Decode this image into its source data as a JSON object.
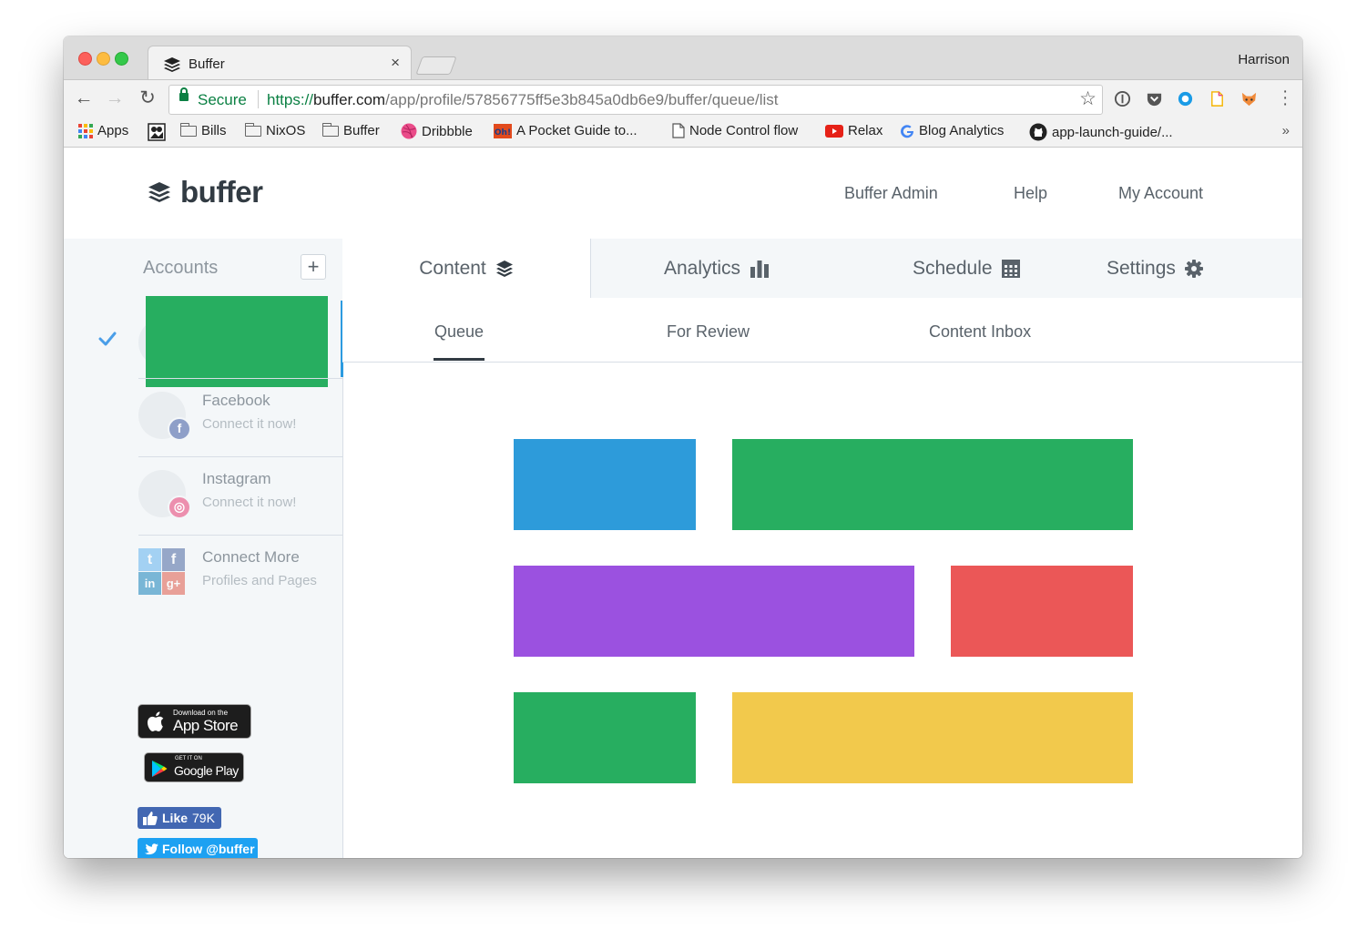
{
  "browser": {
    "tab_title": "Buffer",
    "tab_close": "×",
    "profile_name": "Harrison",
    "secure_label": "Secure",
    "url_scheme": "https://",
    "url_host": "buffer.com",
    "url_path": "/app/profile/57856775ff5e3b845a0db6e9/buffer/queue/list",
    "bookmarks": [
      {
        "label": "Apps",
        "icon": "apps-grid-icon"
      },
      {
        "label": "",
        "icon": "photo-icon"
      },
      {
        "label": "Bills",
        "icon": "folder-icon"
      },
      {
        "label": "NixOS",
        "icon": "folder-icon"
      },
      {
        "label": "Buffer",
        "icon": "folder-icon"
      },
      {
        "label": "Dribbble",
        "icon": "dribbble-icon"
      },
      {
        "label": "A Pocket Guide to...",
        "icon": "oh-icon"
      },
      {
        "label": "Node Control flow",
        "icon": "page-icon"
      },
      {
        "label": "Relax",
        "icon": "youtube-icon"
      },
      {
        "label": "Blog Analytics",
        "icon": "google-icon"
      },
      {
        "label": "app-launch-guide/...",
        "icon": "github-icon"
      }
    ],
    "bookmarks_more": "»"
  },
  "header": {
    "logo_text": "buffer",
    "nav": [
      "Buffer Admin",
      "Help",
      "My Account"
    ]
  },
  "sidebar": {
    "title": "Accounts",
    "add_label": "+",
    "accounts": [
      {
        "name": "Facebook",
        "sub": "Connect it now!",
        "badge": "f",
        "color": "#3b5998"
      },
      {
        "name": "Instagram",
        "sub": "Connect it now!",
        "badge": "◎",
        "color": "#e1306c"
      },
      {
        "name": "Connect More",
        "sub": "Profiles and Pages"
      }
    ],
    "connect_grid": [
      "t",
      "f",
      "in",
      "g+"
    ],
    "app_store": {
      "small": "Download on the",
      "big": "App Store"
    },
    "google_play": {
      "small": "GET IT ON",
      "big": "Google Play"
    },
    "fb_like": {
      "label": "Like",
      "count": "79K"
    },
    "twitter_follow": "Follow @buffer"
  },
  "tabs": {
    "main": [
      "Content",
      "Analytics",
      "Schedule",
      "Settings"
    ],
    "active": "Content",
    "sub": [
      "Queue",
      "For Review",
      "Content Inbox"
    ],
    "active_sub": "Queue"
  },
  "colors": {
    "blue": "#2d9bda",
    "green": "#27ae60",
    "purple": "#9b51e0",
    "red": "#eb5757",
    "yellow": "#f2c94c",
    "accent": "#2c9be0"
  }
}
